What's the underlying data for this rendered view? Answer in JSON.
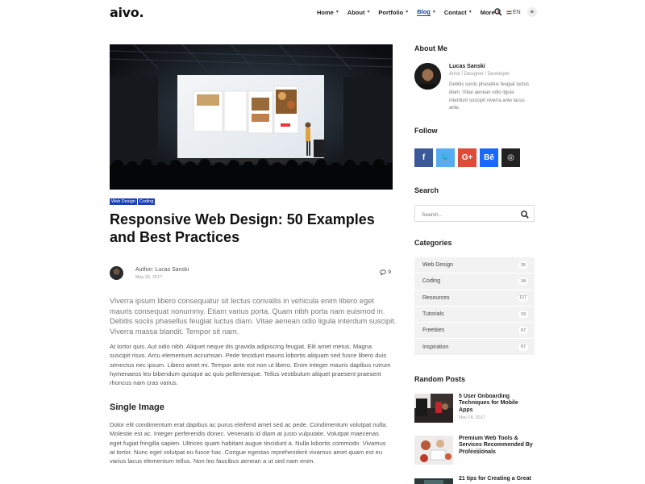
{
  "header": {
    "logo": "aivo.",
    "nav": [
      {
        "label": "Home"
      },
      {
        "label": "About"
      },
      {
        "label": "Portfolio"
      },
      {
        "label": "Blog",
        "active": true
      },
      {
        "label": "Contact"
      },
      {
        "label": "More"
      }
    ],
    "lang": "EN"
  },
  "post": {
    "tags": [
      "Web Design",
      "Coding"
    ],
    "title": "Responsive Web Design: 50 Examples and Best Practices",
    "author_label": "Author: Lucas Sanski",
    "date": "May 26, 2017",
    "comments": "9",
    "lead": "Viverra ipsum libero consequatur sit lectus convallis in vehicula enim libero eget mauris consequat nonummy. Etiam varius porta. Quam nibh porta nam euismod in. Debitis sociis phasellus feugiat luctus diam. Vitae aenean odio ligula interdum suscipit. Viverra massa blandit. Tempor sit nam.",
    "p1": "At tortor quis. Aut odio nibh. Aliquet neque dis gravida adipiscing feugiat. Elit amet metus. Magna suscipit risus. Arcu elementum accumsan. Pede tincidunt mauris lobortis aliquam sed fusce libero duis senectus nec ipsum. Libero amet mi. Tempor ante est non ut libero. Enim integer mauris dapibus rutrum hymenaeos leo bibendum quisque ac quis pellentesque. Tellus vestibulum aliquet praesent praesent rhoncus nam cras varius.",
    "section_heading": "Single Image",
    "p2": "Dolor elit condimentum erat dapibus ac purus eleifend amet sed ac pede. Condimentum volutpat nulla. Molestie est ac. Integer perferendis donec. Venenatis id diam at justo vulputate. Volutpat maecenas eget fugiat fringilla sapien. Ultrices quam habitant augue tincidunt a. Nulla lobortis commodo. Vivamus at tortor. Nunc eget volutpat eu fusce hac. Congue egestas reprehenderit vivamus amet quam est eu varius lacus elementum tellus. Non leo faucibus aenean a ut sed nam enim."
  },
  "sidebar": {
    "about": {
      "heading": "About Me",
      "name": "Lucas Sanski",
      "role": "Artist / Designer / Developer",
      "desc": "Debitis sociis phasellus feugiat luctus diam. Vitae aenean odio ligula interdum suscipit viverra ante lacus ante."
    },
    "follow": {
      "heading": "Follow",
      "networks": [
        {
          "icon": "facebook-icon",
          "glyph": "f",
          "color": "#3b5998"
        },
        {
          "icon": "twitter-icon",
          "glyph": "🐦",
          "color": "#55acee"
        },
        {
          "icon": "google-plus-icon",
          "glyph": "G+",
          "color": "#dd4b39"
        },
        {
          "icon": "behance-icon",
          "glyph": "Bē",
          "color": "#1769ff"
        },
        {
          "icon": "dribbble-icon",
          "glyph": "◎",
          "color": "#222222"
        }
      ]
    },
    "search": {
      "heading": "Search",
      "placeholder": "Search..."
    },
    "categories": {
      "heading": "Categories",
      "items": [
        {
          "label": "Web Design",
          "count": "26"
        },
        {
          "label": "Coding",
          "count": "34"
        },
        {
          "label": "Resources",
          "count": "127"
        },
        {
          "label": "Tutorials",
          "count": "19"
        },
        {
          "label": "Freebies",
          "count": "67"
        },
        {
          "label": "Inspiration",
          "count": "67"
        }
      ]
    },
    "random": {
      "heading": "Random Posts",
      "items": [
        {
          "title": "5 User Onboarding Techniques for Mobile Apps",
          "date": "Nov 14, 2017"
        },
        {
          "title": "Premium Web Tools & Services Recommended By Professionals",
          "date": "Nov 14, 2017"
        },
        {
          "title": "21 tips for Creating a Great",
          "date": ""
        }
      ]
    }
  }
}
